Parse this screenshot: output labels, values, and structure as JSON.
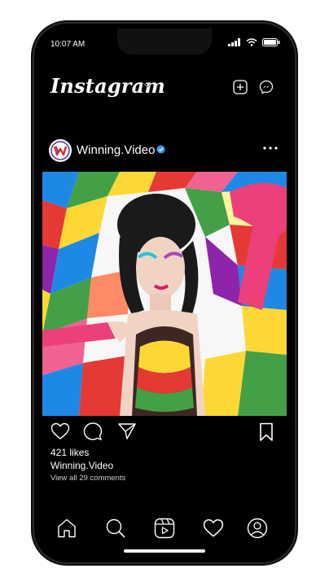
{
  "status": {
    "time": "10:07 AM"
  },
  "header": {
    "app_name": "Instagram"
  },
  "post": {
    "avatar_letter": "W",
    "username": "Winning.Video",
    "likes_text": "421 likes",
    "caption_user": "Winning.Video",
    "comments_text": "View all 29 comments"
  },
  "icons": {
    "header": [
      "chevron-down-icon",
      "new-post-icon",
      "messenger-icon"
    ],
    "actions": [
      "heart-icon",
      "comment-icon",
      "share-icon",
      "bookmark-icon"
    ],
    "tabs": [
      "home-icon",
      "search-icon",
      "reels-icon",
      "activity-heart-icon",
      "profile-icon"
    ]
  },
  "colors": {
    "background": "#000000",
    "text": "#ffffff",
    "verified": "#3897f0",
    "brand_logo": "#5b2d8e"
  }
}
